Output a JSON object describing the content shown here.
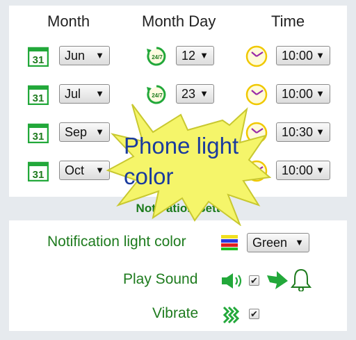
{
  "headers": {
    "month": "Month",
    "month_day": "Month Day",
    "time": "Time"
  },
  "calendar_icon_text": "31",
  "always_icon_text": "24/7",
  "rows": [
    {
      "month": "Jun",
      "day": "12",
      "time": "10:00"
    },
    {
      "month": "Jul",
      "day": "23",
      "time": "10:00"
    },
    {
      "month": "Sep",
      "day": "",
      "time": "10:30"
    },
    {
      "month": "Oct",
      "day": "",
      "time": "10:00"
    }
  ],
  "arrow": "▼",
  "notification_section": {
    "title": "Notif   ation   Sett"
  },
  "notification_light": {
    "label": "Notification light color",
    "value": "Green"
  },
  "play_sound": {
    "label": "Play Sound",
    "checked": true
  },
  "vibrate": {
    "label": "Vibrate",
    "checked": true
  },
  "callout": {
    "text": "Phone light color"
  },
  "checkmark": "✔",
  "colors": {
    "accent_green": "#1e7b1e",
    "callout_yellow": "#f5f56a",
    "callout_text": "#1a3b9e"
  }
}
